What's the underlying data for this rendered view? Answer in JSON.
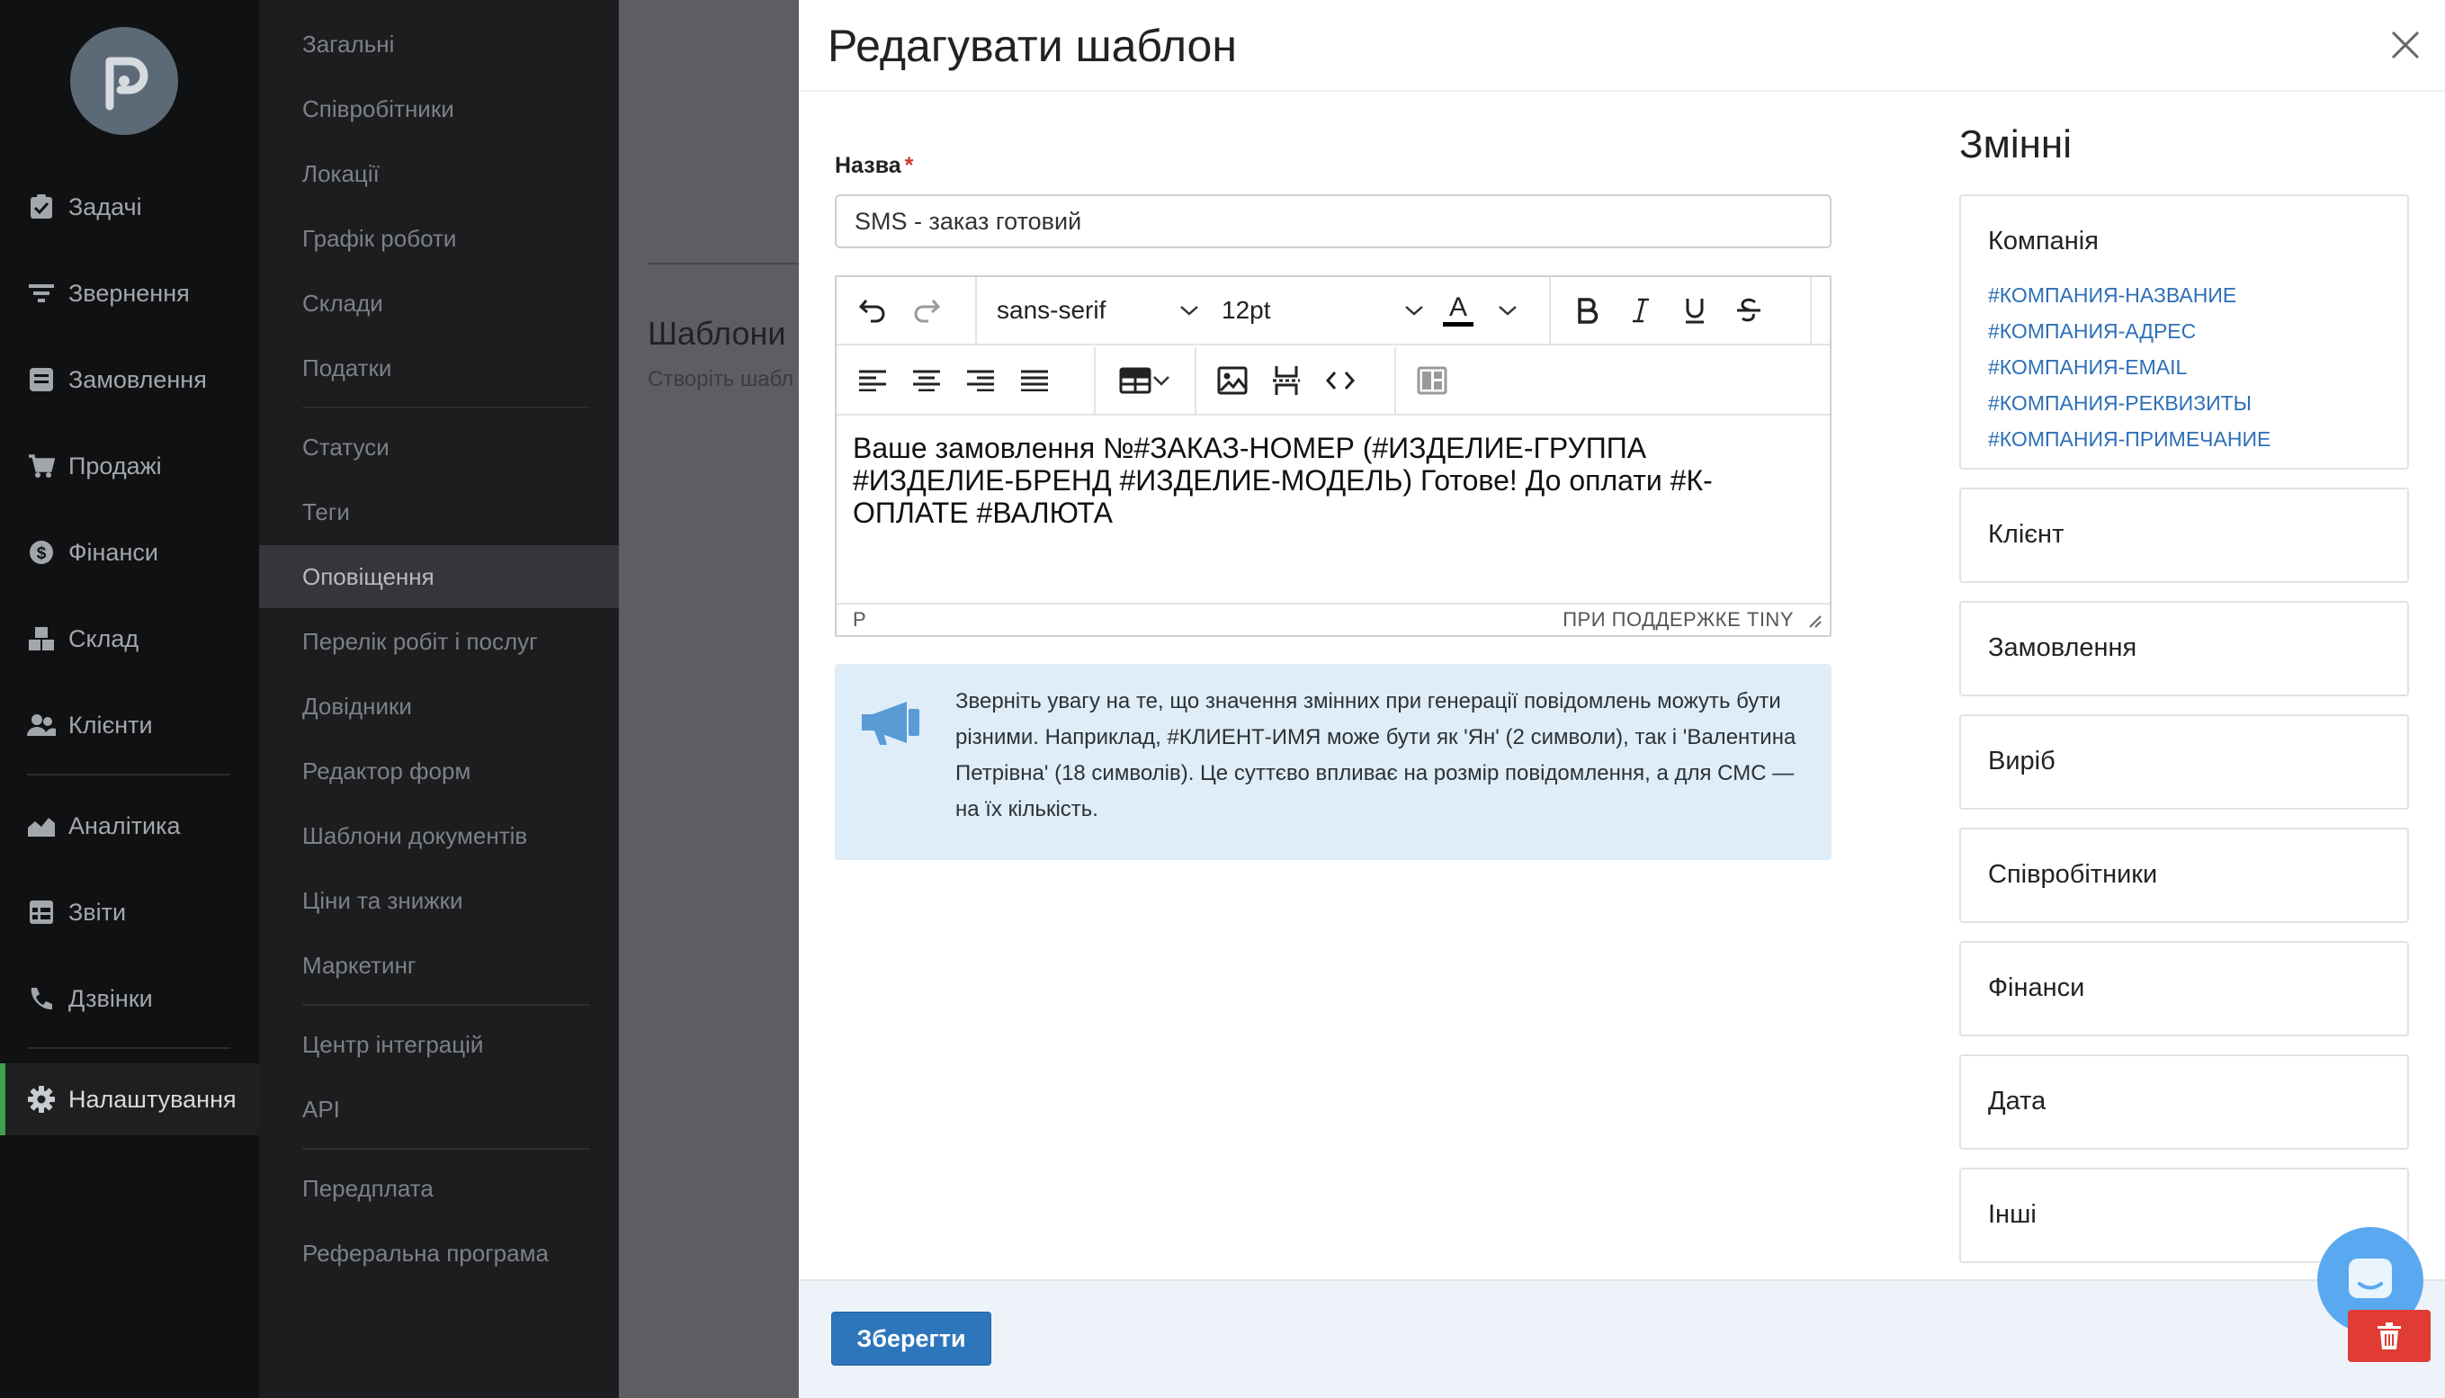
{
  "nav": {
    "items": [
      {
        "label": "Задачі",
        "icon": "clipboard-check-icon"
      },
      {
        "label": "Звернення",
        "icon": "filter-icon"
      },
      {
        "label": "Замовлення",
        "icon": "form-icon"
      },
      {
        "label": "Продажі",
        "icon": "cart-icon"
      },
      {
        "label": "Фінанси",
        "icon": "dollar-icon"
      },
      {
        "label": "Склад",
        "icon": "boxes-icon"
      },
      {
        "label": "Клієнти",
        "icon": "users-icon"
      },
      {
        "label": "Аналітика",
        "icon": "area-chart-icon"
      },
      {
        "label": "Звіти",
        "icon": "table-icon"
      },
      {
        "label": "Дзвінки",
        "icon": "phone-icon"
      },
      {
        "label": "Налаштування",
        "icon": "gear-icon"
      }
    ],
    "active": "Налаштування"
  },
  "submenu": {
    "items": [
      "Загальні",
      "Співробітники",
      "Локації",
      "Графік роботи",
      "Склади",
      "Податки",
      "Статуси",
      "Теги",
      "Оповіщення",
      "Перелік робіт і послуг",
      "Довідники",
      "Редактор форм",
      "Шаблони документів",
      "Ціни та знижки",
      "Маркетинг",
      "Центр інтеграцій",
      "API",
      "Передплата",
      "Реферальна програма"
    ],
    "active": "Оповіщення"
  },
  "background_page": {
    "title": "Шаблони",
    "subtitle": "Створіть шабл"
  },
  "modal": {
    "title": "Редагувати шаблон",
    "name_label": "Назва",
    "required_mark": "*",
    "name_value": "SMS - заказ готовий",
    "editor": {
      "font_family": "sans-serif",
      "font_size": "12pt",
      "text_color_letter": "A",
      "content": "Ваше замовлення №#ЗАКАЗ-НОМЕР (#ИЗДЕЛИЕ-ГРУППА #ИЗДЕЛИЕ-БРЕНД #ИЗДЕЛИЕ-МОДЕЛЬ) Готове! До оплати #К-ОПЛАТЕ #ВАЛЮТА",
      "status_path": "P",
      "powered_by": "ПРИ ПОДДЕРЖКЕ TINY"
    },
    "notice": "Зверніть увагу на те, що значення змінних при генерації повідомлень можуть бути різними. Наприклад, #КЛИЕНТ-ИМЯ може бути як 'Ян' (2 символи), так і 'Валентина Петрівна' (18 символів). Це суттєво впливає на розмір повідомлення, а для СМС — на їх кількість.",
    "save_label": "Зберегти",
    "accent_color": "#2d76bc"
  },
  "variables": {
    "title": "Змінні",
    "groups": [
      {
        "label": "Компанія",
        "items": [
          "#КОМПАНИЯ-НАЗВАНИЕ",
          "#КОМПАНИЯ-АДРЕС",
          "#КОМПАНИЯ-EMAIL",
          "#КОМПАНИЯ-РЕКВИЗИТЫ",
          "#КОМПАНИЯ-ПРИМЕЧАНИЕ"
        ]
      },
      {
        "label": "Клієнт"
      },
      {
        "label": "Замовлення"
      },
      {
        "label": "Виріб"
      },
      {
        "label": "Співробітники"
      },
      {
        "label": "Фінанси"
      },
      {
        "label": "Дата"
      },
      {
        "label": "Інші"
      }
    ]
  }
}
